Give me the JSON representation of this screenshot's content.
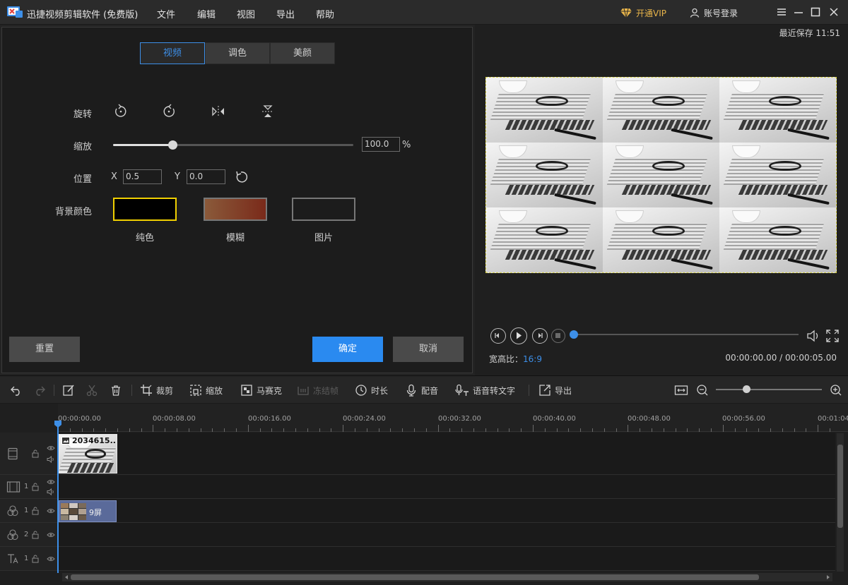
{
  "app": {
    "title": "迅捷视频剪辑软件 (免费版)",
    "menu": [
      "文件",
      "编辑",
      "视图",
      "导出",
      "帮助"
    ],
    "vip_label": "开通VIP",
    "login_label": "账号登录"
  },
  "left_panel": {
    "tabs": [
      {
        "label": "视频",
        "active": true
      },
      {
        "label": "调色",
        "active": false
      },
      {
        "label": "美颜",
        "active": false
      }
    ],
    "rotate_label": "旋转",
    "zoom_label": "缩放",
    "zoom_value": "100.0",
    "zoom_unit": "%",
    "position_label": "位置",
    "x_label": "X",
    "x_value": "0.5",
    "y_label": "Y",
    "y_value": "0.0",
    "bg_label": "背景颜色",
    "bg_options": [
      {
        "label": "纯色",
        "selected": true
      },
      {
        "label": "模糊",
        "selected": false
      },
      {
        "label": "图片",
        "selected": false
      }
    ],
    "reset_label": "重置",
    "ok_label": "确定",
    "cancel_label": "取消",
    "colors": {
      "accent": "#3d8fe8",
      "selected_border": "#f0d000",
      "ok_button": "#2a8af0"
    }
  },
  "preview": {
    "last_save": "最近保存 11:51",
    "aspect_label": "宽高比：",
    "aspect_value": "16:9",
    "timecode": "00:00:00.00 / 00:00:05.00",
    "progress": 0
  },
  "toolbar": {
    "crop_label": "裁剪",
    "zoom_label": "缩放",
    "mosaic_label": "马赛克",
    "freeze_label": "冻结帧",
    "duration_label": "时长",
    "dub_label": "配音",
    "speech_label": "语音转文字",
    "export_label": "导出"
  },
  "timeline": {
    "ruler_labels": [
      "00:00:00.00",
      "00:00:08.00",
      "00:00:16.00",
      "00:00:24.00",
      "00:00:32.00",
      "00:00:40.00",
      "00:00:48.00",
      "00:00:56.00",
      "00:01:04"
    ],
    "tracks": [
      {
        "icon": "video-track-icon",
        "num": ""
      },
      {
        "icon": "film-track-icon",
        "num": "1"
      },
      {
        "icon": "effects-track-icon",
        "num": "1"
      },
      {
        "icon": "effects-track-icon",
        "num": "2"
      },
      {
        "icon": "text-track-icon",
        "num": "1"
      }
    ],
    "video_clip_label": "2034615...",
    "fx_clip_label": "9屏"
  }
}
